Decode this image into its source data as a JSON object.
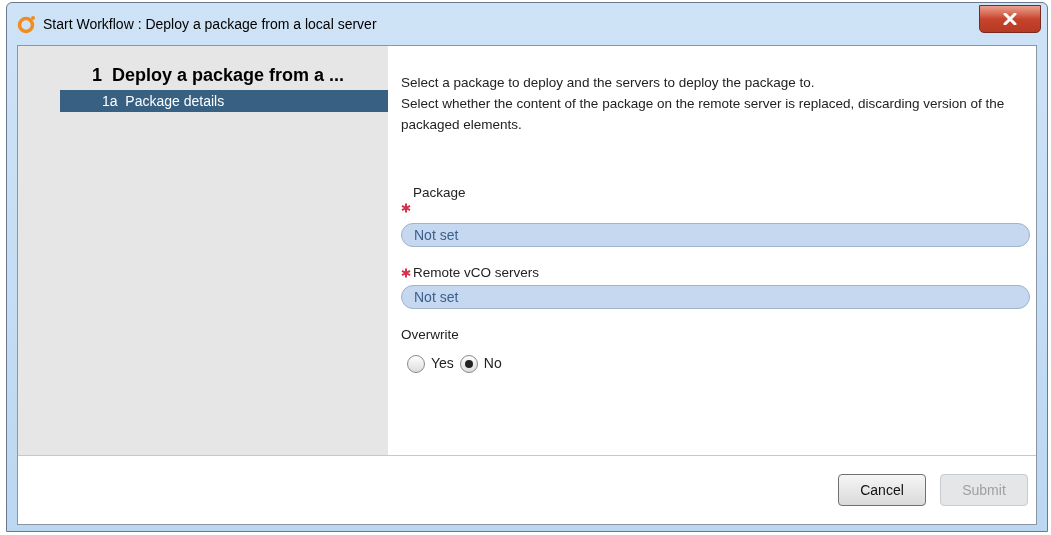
{
  "window": {
    "title": "Start Workflow : Deploy a package from a local server"
  },
  "steps": [
    {
      "label": "1  Deploy a package from a ...",
      "selected": false,
      "children": [
        {
          "label": "1a  Package details",
          "selected": true
        }
      ]
    }
  ],
  "description": [
    "Select a package to deploy and the servers to deploy the package to.",
    "Select whether the content of the package on the remote server is replaced, discarding version of the packaged elements."
  ],
  "fields": [
    {
      "kind": "picker",
      "label": "Package",
      "required": true,
      "value": "Not set"
    },
    {
      "kind": "picker",
      "label": "Remote vCO servers",
      "required": true,
      "value": "Not set"
    },
    {
      "kind": "radio",
      "label": "Overwrite",
      "required": false,
      "options": [
        {
          "label": "Yes",
          "selected": false
        },
        {
          "label": "No",
          "selected": true
        }
      ]
    }
  ],
  "buttons": [
    {
      "label": "Cancel",
      "disabled": false
    },
    {
      "label": "Submit",
      "disabled": true
    }
  ]
}
